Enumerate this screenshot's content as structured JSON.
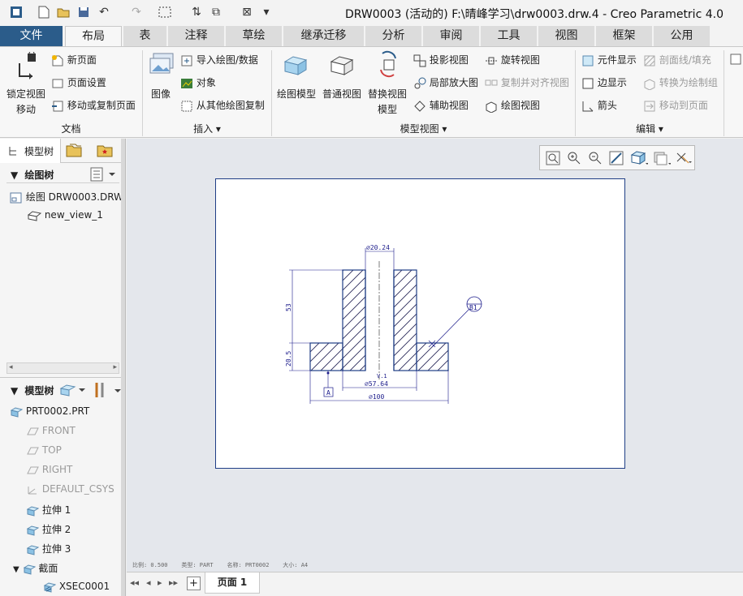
{
  "window": {
    "title": "DRW0003 (活动的) F:\\晴峰学习\\drw0003.drw.4 - Creo Parametric 4.0"
  },
  "tabs": [
    "文件",
    "布局",
    "表",
    "注释",
    "草绘",
    "继承迁移",
    "分析",
    "审阅",
    "工具",
    "视图",
    "框架",
    "公用"
  ],
  "ribbon": {
    "doc": {
      "lock_view_l1": "锁定视图",
      "lock_view_l2": "移动",
      "new_page": "新页面",
      "page_setup": "页面设置",
      "move_copy_page": "移动或复制页面",
      "group": "文档"
    },
    "insert": {
      "image": "图像",
      "import": "导入绘图/数据",
      "object": "对象",
      "copy_from_drawing": "从其他绘图复制",
      "group": "插入"
    },
    "model_views": {
      "drawing_model": "绘图模型",
      "general_view": "普通视图",
      "replace_l1": "替换视图",
      "replace_l2": "模型",
      "projection": "投影视图",
      "detail": "局部放大图",
      "auxiliary": "辅助视图",
      "revolve": "旋转视图",
      "copy_align": "复制并对齐视图",
      "drawing_view": "绘图视图",
      "group": "模型视图"
    },
    "edit": {
      "component_display": "元件显示",
      "edge_display": "边显示",
      "arrow": "箭头",
      "xsec_fill": "剖面线/填充",
      "convert_group": "转换为绘制组",
      "move_to_page": "移动到页面",
      "group": "编辑"
    }
  },
  "left_panel": {
    "model_tree_tab": "模型树",
    "drawing_tree_label": "绘图树",
    "drawing_item": "绘图 DRW0003.DRW",
    "view_item": "new_view_1",
    "model_tree_label": "模型树",
    "model_items": [
      "PRT0002.PRT",
      "FRONT",
      "TOP",
      "RIGHT",
      "DEFAULT_CSYS",
      "拉伸 1",
      "拉伸 2",
      "拉伸 3",
      "截面",
      "XSEC0001"
    ]
  },
  "drawing": {
    "dim_top": "⌀20.24",
    "dim_height": "53",
    "dim_flange": "20.5",
    "dim_mid": "⌀57.64",
    "dim_overall": "⌀100",
    "datum": "A",
    "balloon": "B1",
    "view_label": "V.1"
  },
  "status_line": "比例: 0.500    类型: PART    名称: PRT0002    大小: A4",
  "bottom": {
    "page_tab": "页面 1",
    "add": "+"
  },
  "colors": {
    "file_tab": "#2b5c8a",
    "sheet_border": "#1f3e86",
    "canvas_bg": "#e4e7ec",
    "dim": "#1a1a8a"
  }
}
